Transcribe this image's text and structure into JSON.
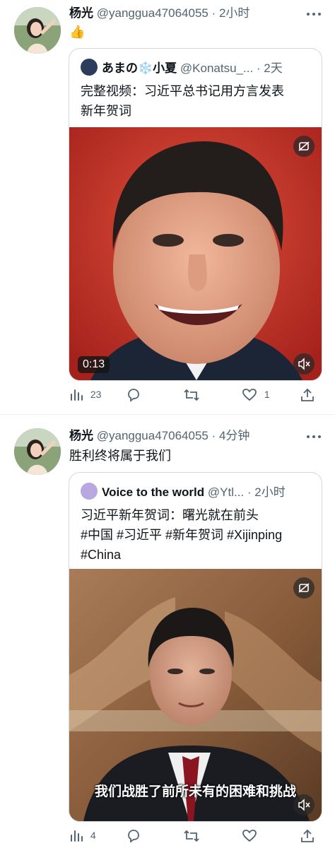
{
  "tweets": [
    {
      "name": "杨光",
      "handle": "@yanggua47064055",
      "time": "· 2小时",
      "text": "👍",
      "quote": {
        "name": "あまの❄️小夏",
        "handle": "@Konatsu_...",
        "time": "· 2天",
        "text_lines": [
          "完整视频：习近平总书记用方言发表",
          "新年贺词"
        ],
        "video_duration": "0:13"
      },
      "stats": {
        "views": "23",
        "replies": "",
        "retweets": "",
        "likes": "1"
      }
    },
    {
      "name": "杨光",
      "handle": "@yanggua47064055",
      "time": "· 4分钟",
      "text": "胜利终将属于我们",
      "quote": {
        "name": "Voice to the world",
        "handle": "@Ytl...",
        "time": "· 2小时",
        "text_lines": [
          "习近平新年贺词：曙光就在前头",
          "#中国 #习近平 #新年贺词 #Xijinping",
          "#China"
        ],
        "video_subtitle": "我们战胜了前所未有的困难和挑战"
      },
      "stats": {
        "views": "4",
        "replies": "",
        "retweets": "",
        "likes": ""
      }
    }
  ],
  "icons": {
    "views": "bar-chart-icon",
    "reply": "speech-bubble-icon",
    "retweet": "retweet-icon",
    "like": "heart-icon",
    "share": "share-icon",
    "mute": "speaker-muted-icon",
    "media_badge": "sensitive-media-icon",
    "more": "more-dots-icon"
  },
  "colors": {
    "text": "#0f1419",
    "secondary": "#536471",
    "border": "#cfd9de"
  }
}
